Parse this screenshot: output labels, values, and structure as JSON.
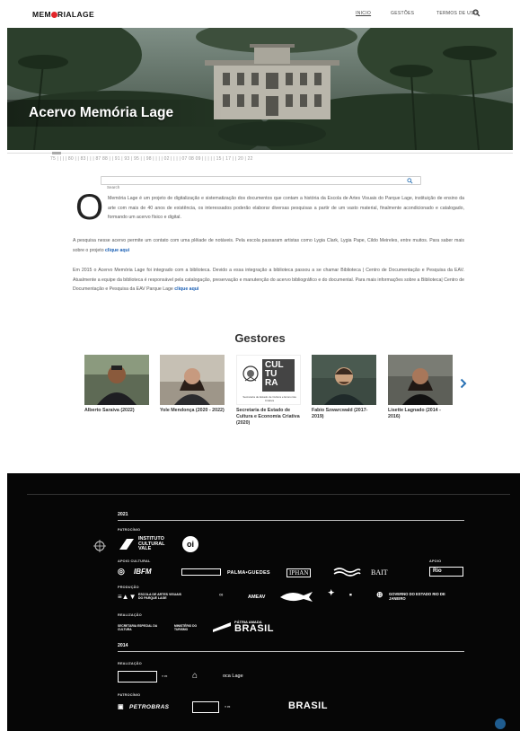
{
  "header": {
    "logo_left": "MEM",
    "logo_right": "RIALAGE",
    "nav": [
      "INICIO",
      "GESTÕES",
      "TERMOS DE USO"
    ]
  },
  "hero": {
    "title": "Acervo Memória Lage"
  },
  "timeline": {
    "text": "75  |  |  |  | 80 |  | 83 |  |  | 87 88 |  | 91 | 93 | 95 |  | 98 |  |  |  | 02 |  |  |  | 07 08 09 |  |  |  |  | 15 |  17 |  |  20 |  22"
  },
  "search": {
    "placeholder": "Search"
  },
  "intro": {
    "drop_cap": "O",
    "text": "Memória Lage é um projeto de digitalização e sistematização dos documentos que contam a história da Escola de Artes Visuais do Parque Lage, instituição de ensino da arte com mais de 40 anos  de existência, os interessados poderão elaborar diversas pesquisas a partir de um vasto material, finalmente acondicionado e catalogado, formando um acervo físico e digital."
  },
  "para1": {
    "text": "A pesquisa nesse acervo permite um contato com uma plêiade de notáveis. Pela escola passaram artistas como Lygia Clark, Lygia Pape, Cildo Meireles, entre muitos.  Para saber mais sobre o projeto ",
    "link": "clique aqui"
  },
  "para2": {
    "text": "Em 2015 o Acervo Memória Lage foi integrado com a biblioteca. Devido a essa integração a biblioteca passou a se chamar Biblioteca | Centro de Documentação e Pesquisa da EAV. Atualmente a equipe da biblioteca é responsável pela catalogação, preservação e manutenção do acervo bibliográfico e do documental. Para mais informações sobre a Biblioteca| Centro de Documentação e Pesquisa da EAV Parque Lage ",
    "link": "clique aqui"
  },
  "gestores": {
    "title": "Gestores",
    "cards": [
      {
        "name": "Alberto Saraiva (2022)"
      },
      {
        "name": "Yole Mendonça (2020 - 2022)"
      },
      {
        "name": "Secretaria de Estado de Cultura e Economia Criativa (2020)",
        "logo_line1": "CUL",
        "logo_line2": "TU",
        "logo_line3": "RA",
        "logo_caption": "Secretaria de Estado de Cultura e Economia Criativa"
      },
      {
        "name": "Fabio Szwarcwald (2017-2019)"
      },
      {
        "name": "Lisette Lagnado (2014 - 2016)"
      }
    ]
  },
  "footer": {
    "year1": "2021",
    "patrocinio1": "PATROCÍNIO",
    "instituto": [
      "INSTITUTO",
      "CULTURAL",
      "VALE"
    ],
    "oi": "oi",
    "apoio_cultural": "APOIO CULTURAL",
    "apoio": "APOIO",
    "apoio_logos": [
      "IBFM",
      "PALMA•GUEDES",
      "IPHAN",
      "BAIT",
      "Rio"
    ],
    "producao": "PRODUÇÃO",
    "producao_logos": [
      "ESCOLA DE ARTES VISUAIS DO PARQUE LAGE",
      "AMEAV",
      "GOVERNO DO ESTADO RIO DE JANEIRO"
    ],
    "realizacao1": "REALIZAÇÃO",
    "realizacao_logos": [
      "SECRETARIA ESPECIAL DA CULTURA",
      "MINISTÉRIO DO TURISMO",
      "PÁTRIA AMADA",
      "BRASIL"
    ],
    "year2": "2014",
    "realizacao2": "REALIZAÇÃO",
    "realizacao2_logos": [
      "oca Lage"
    ],
    "patrocinio2": "PATROCÍNIO",
    "patrocinio2_logos": [
      "PETROBRAS",
      "BRASIL"
    ]
  },
  "colors": {
    "accent": "#e2262a",
    "link": "#1a5fb4",
    "footer_bg": "#060606"
  }
}
